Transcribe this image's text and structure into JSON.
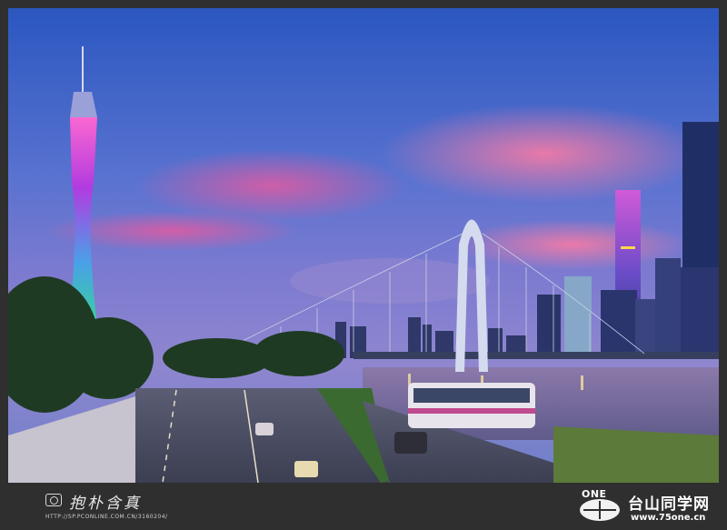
{
  "photo": {
    "subject": "city-skyline-at-dusk",
    "colors": {
      "sky_top": "#2d58c2",
      "sky_mid": "#5f74d2",
      "sky_pink": "#e86fa3",
      "river": "#7a6c9c",
      "tower_glow": "#b03ad8",
      "tower_green": "#34c38f"
    }
  },
  "watermark_left": {
    "camera_icon": "camera-icon",
    "signature": "抱朴含真",
    "url": "HTTP://SP.PCONLINE.COM.CN/3160204/"
  },
  "watermark_right": {
    "logo_text": "ONE",
    "site_name": "台山同学网",
    "site_url": "www.75one.cn"
  }
}
